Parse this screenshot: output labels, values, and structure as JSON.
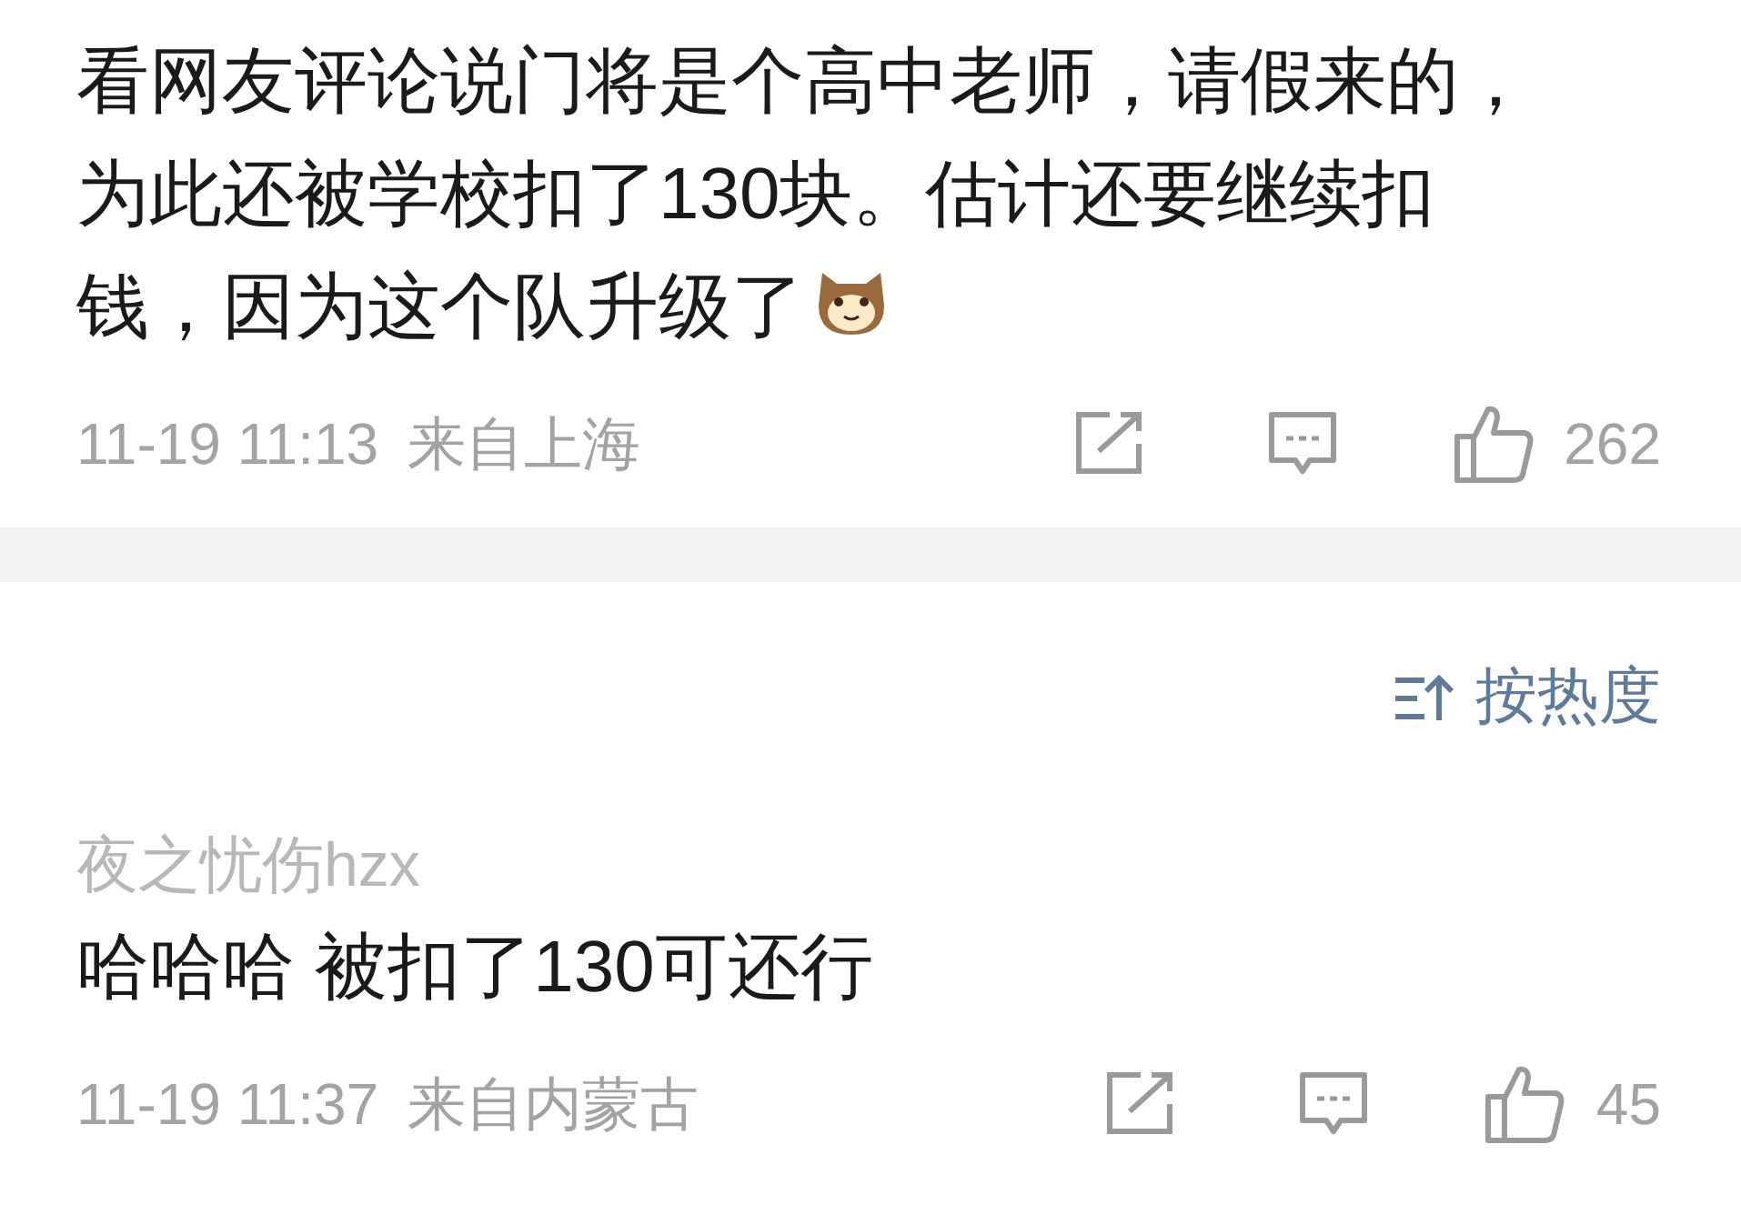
{
  "comments": [
    {
      "lines": [
        "看网友评论说门将是个高中老师，请假来的，",
        "为此还被学校扣了130块。估计还要继续扣",
        "钱，因为这个队升级了"
      ],
      "emoji": true,
      "time": "11-19 11:13",
      "location": "来自上海",
      "likes": "262"
    },
    {
      "author": "夜之忧伤hzx",
      "lines": [
        "哈哈哈 被扣了130可还行"
      ],
      "emoji": false,
      "time": "11-19 11:37",
      "location": "来自内蒙古",
      "likes": "45"
    }
  ],
  "sort": {
    "label": "按热度"
  }
}
